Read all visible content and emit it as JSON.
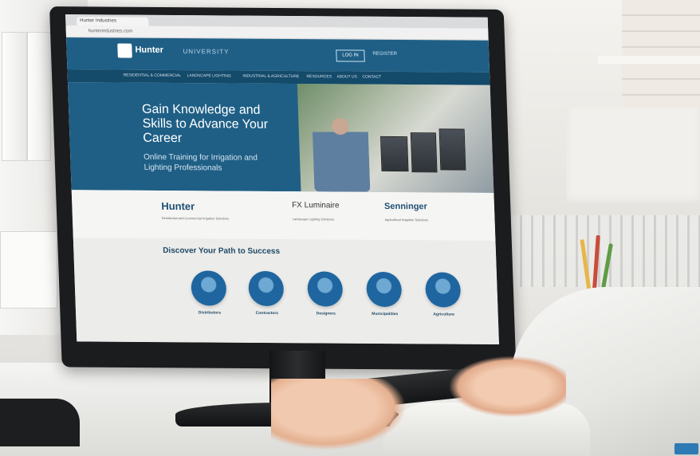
{
  "browser": {
    "tab_title": "Hunter Industries",
    "url": "hunterindustries.com"
  },
  "site": {
    "logo": "Hunter",
    "logo_sub": "UNIVERSITY",
    "signin": "LOG IN",
    "register": "REGISTER"
  },
  "nav": [
    "RESIDENTIAL & COMMERCIAL",
    "LANDSCAPE LIGHTING",
    "INDUSTRIAL & AGRICULTURE",
    "RESOURCES",
    "ABOUT US",
    "CONTACT"
  ],
  "hero": {
    "title": "Gain Knowledge and Skills to Advance Your Career",
    "subtitle": "Online Training for Irrigation and Lighting Professionals"
  },
  "brands": [
    {
      "name": "Hunter",
      "sub": "Residential and Commercial Irrigation Solutions"
    },
    {
      "name": "FX Luminaire",
      "sub": "Landscape Lighting Solutions"
    },
    {
      "name": "Senninger",
      "sub": "Agricultural Irrigation Solutions"
    }
  ],
  "discover": {
    "title": "Discover Your Path to Success",
    "paths": [
      "Distributors",
      "Contractors",
      "Designers",
      "Municipalities",
      "Agriculture"
    ]
  }
}
